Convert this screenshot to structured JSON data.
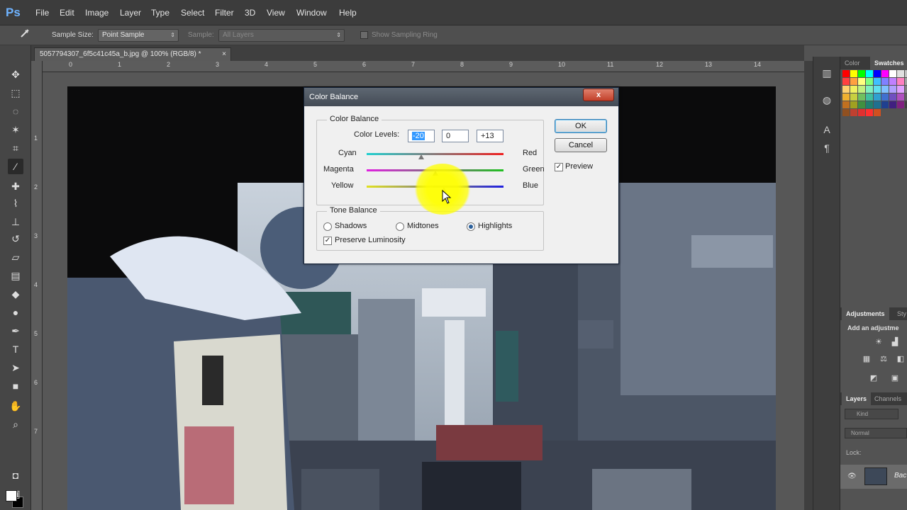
{
  "app": {
    "logo": "Ps"
  },
  "menu": [
    "File",
    "Edit",
    "Image",
    "Layer",
    "Type",
    "Select",
    "Filter",
    "3D",
    "View",
    "Window",
    "Help"
  ],
  "options": {
    "sample_size_label": "Sample Size:",
    "sample_size_value": "Point Sample",
    "sample_label": "Sample:",
    "sample_value": "All Layers",
    "show_ring_label": "Show Sampling Ring"
  },
  "document": {
    "tab_title": "5057794307_6f5c41c45a_b.jpg @ 100% (RGB/8) *",
    "close": "×"
  },
  "ruler": {
    "top": [
      "0",
      "1",
      "2",
      "3",
      "4",
      "5",
      "6",
      "7",
      "8",
      "9",
      "10",
      "11",
      "12",
      "13",
      "14"
    ],
    "left": [
      "1",
      "2",
      "3",
      "4",
      "5",
      "6",
      "7"
    ]
  },
  "dialog": {
    "title": "Color Balance",
    "close": "x",
    "color_balance_group": "Color Balance",
    "color_levels_label": "Color Levels:",
    "levels": [
      "-20",
      "0",
      "+13"
    ],
    "sliders": [
      {
        "left": "Cyan",
        "right": "Red",
        "value": -20
      },
      {
        "left": "Magenta",
        "right": "Green",
        "value": 0
      },
      {
        "left": "Yellow",
        "right": "Blue",
        "value": 13
      }
    ],
    "tone_group": "Tone Balance",
    "tones": [
      "Shadows",
      "Midtones",
      "Highlights"
    ],
    "selected_tone": "Highlights",
    "preserve_luminosity": "Preserve Luminosity",
    "ok": "OK",
    "cancel": "Cancel",
    "preview": "Preview"
  },
  "panels": {
    "top_tabs": [
      "Color",
      "Swatches"
    ],
    "adj_tabs": [
      "Adjustments",
      "Sty"
    ],
    "adj_text": "Add an adjustme",
    "layer_tabs": [
      "Layers",
      "Channels"
    ],
    "kind": "Kind",
    "blend": "Normal",
    "lock": "Lock:",
    "layer_name": "Bac"
  },
  "colors": {
    "accent": "#3399ff",
    "highlight": "#ffff00"
  }
}
